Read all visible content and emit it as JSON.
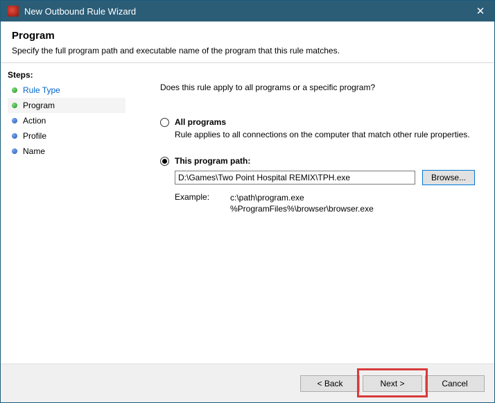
{
  "titlebar": {
    "text": "New Outbound Rule Wizard"
  },
  "header": {
    "title": "Program",
    "desc": "Specify the full program path and executable name of the program that this rule matches."
  },
  "sidebar": {
    "title": "Steps:",
    "items": [
      {
        "label": "Rule Type"
      },
      {
        "label": "Program"
      },
      {
        "label": "Action"
      },
      {
        "label": "Profile"
      },
      {
        "label": "Name"
      }
    ]
  },
  "content": {
    "prompt": "Does this rule apply to all programs or a specific program?",
    "option_all": {
      "label": "All programs",
      "desc": "Rule applies to all connections on the computer that match other rule properties."
    },
    "option_path": {
      "label": "This program path:",
      "value": "D:\\Games\\Two Point Hospital REMIX\\TPH.exe",
      "browse": "Browse..."
    },
    "example": {
      "label": "Example:",
      "line1": "c:\\path\\program.exe",
      "line2": "%ProgramFiles%\\browser\\browser.exe"
    }
  },
  "footer": {
    "back": "< Back",
    "next": "Next >",
    "cancel": "Cancel"
  }
}
